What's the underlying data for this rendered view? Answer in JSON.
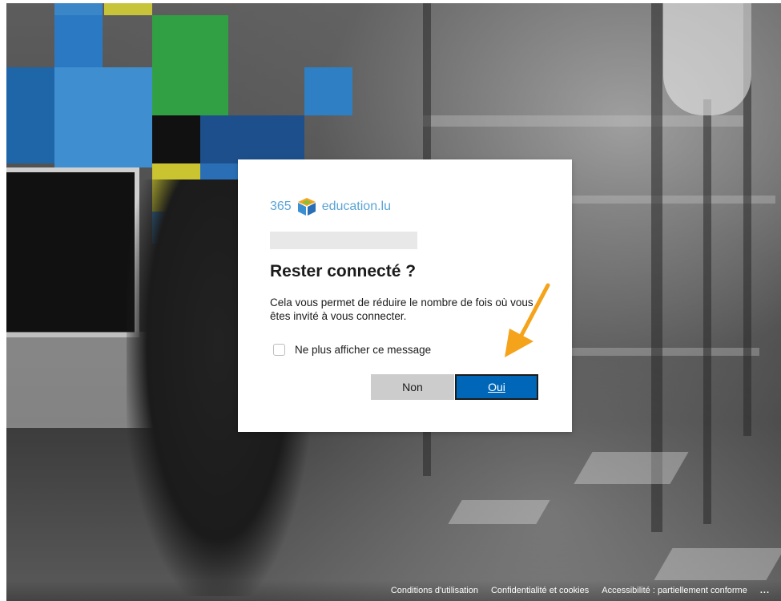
{
  "dialog": {
    "logo": {
      "prefix": "365",
      "suffix": "education.lu",
      "icon": "education-cube-icon"
    },
    "username_redacted": "",
    "title": "Rester connecté ?",
    "description": "Cela vous permet de réduire le nombre de fois où vous êtes invité à vous connecter.",
    "checkbox_label": "Ne plus afficher ce message",
    "checkbox_checked": false,
    "button_no": "Non",
    "button_yes": "Oui"
  },
  "footer": {
    "links": [
      "Conditions d'utilisation",
      "Confidentialité et cookies",
      "Accessibilité : partiellement conforme"
    ],
    "more": "..."
  },
  "colors": {
    "primary_button": "#0067b8",
    "secondary_button": "#cccccc",
    "logo_text": "#5aa4d6",
    "annotation_arrow": "#f5a31a"
  }
}
